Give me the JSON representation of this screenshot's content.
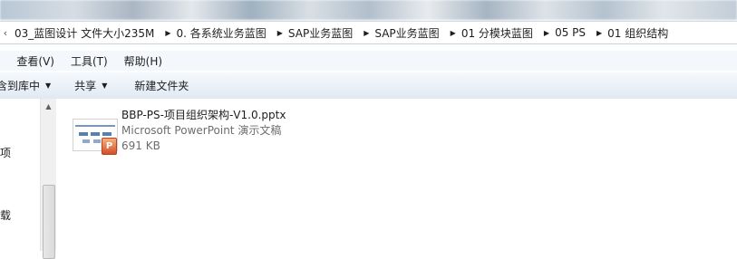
{
  "address": {
    "segments": [
      "03_蓝图设计 文件大小235M",
      "0. 各系统业务蓝图",
      "SAP业务蓝图",
      "SAP业务蓝图",
      "01 分模块蓝图",
      "05 PS",
      "01 组织结构"
    ]
  },
  "menu": {
    "items": [
      "助(H)",
      "查看(V)",
      "工具(T)",
      "帮助(H)"
    ]
  },
  "toolbar": {
    "include_library": "含到库中",
    "share": "共享",
    "new_folder": "新建文件夹"
  },
  "nav": {
    "labels": [
      "项",
      "载"
    ]
  },
  "file": {
    "name": "BBP-PS-项目组织架构-V1.0.pptx",
    "type": "Microsoft PowerPoint 演示文稿",
    "size": "691 KB",
    "badge": "P"
  }
}
